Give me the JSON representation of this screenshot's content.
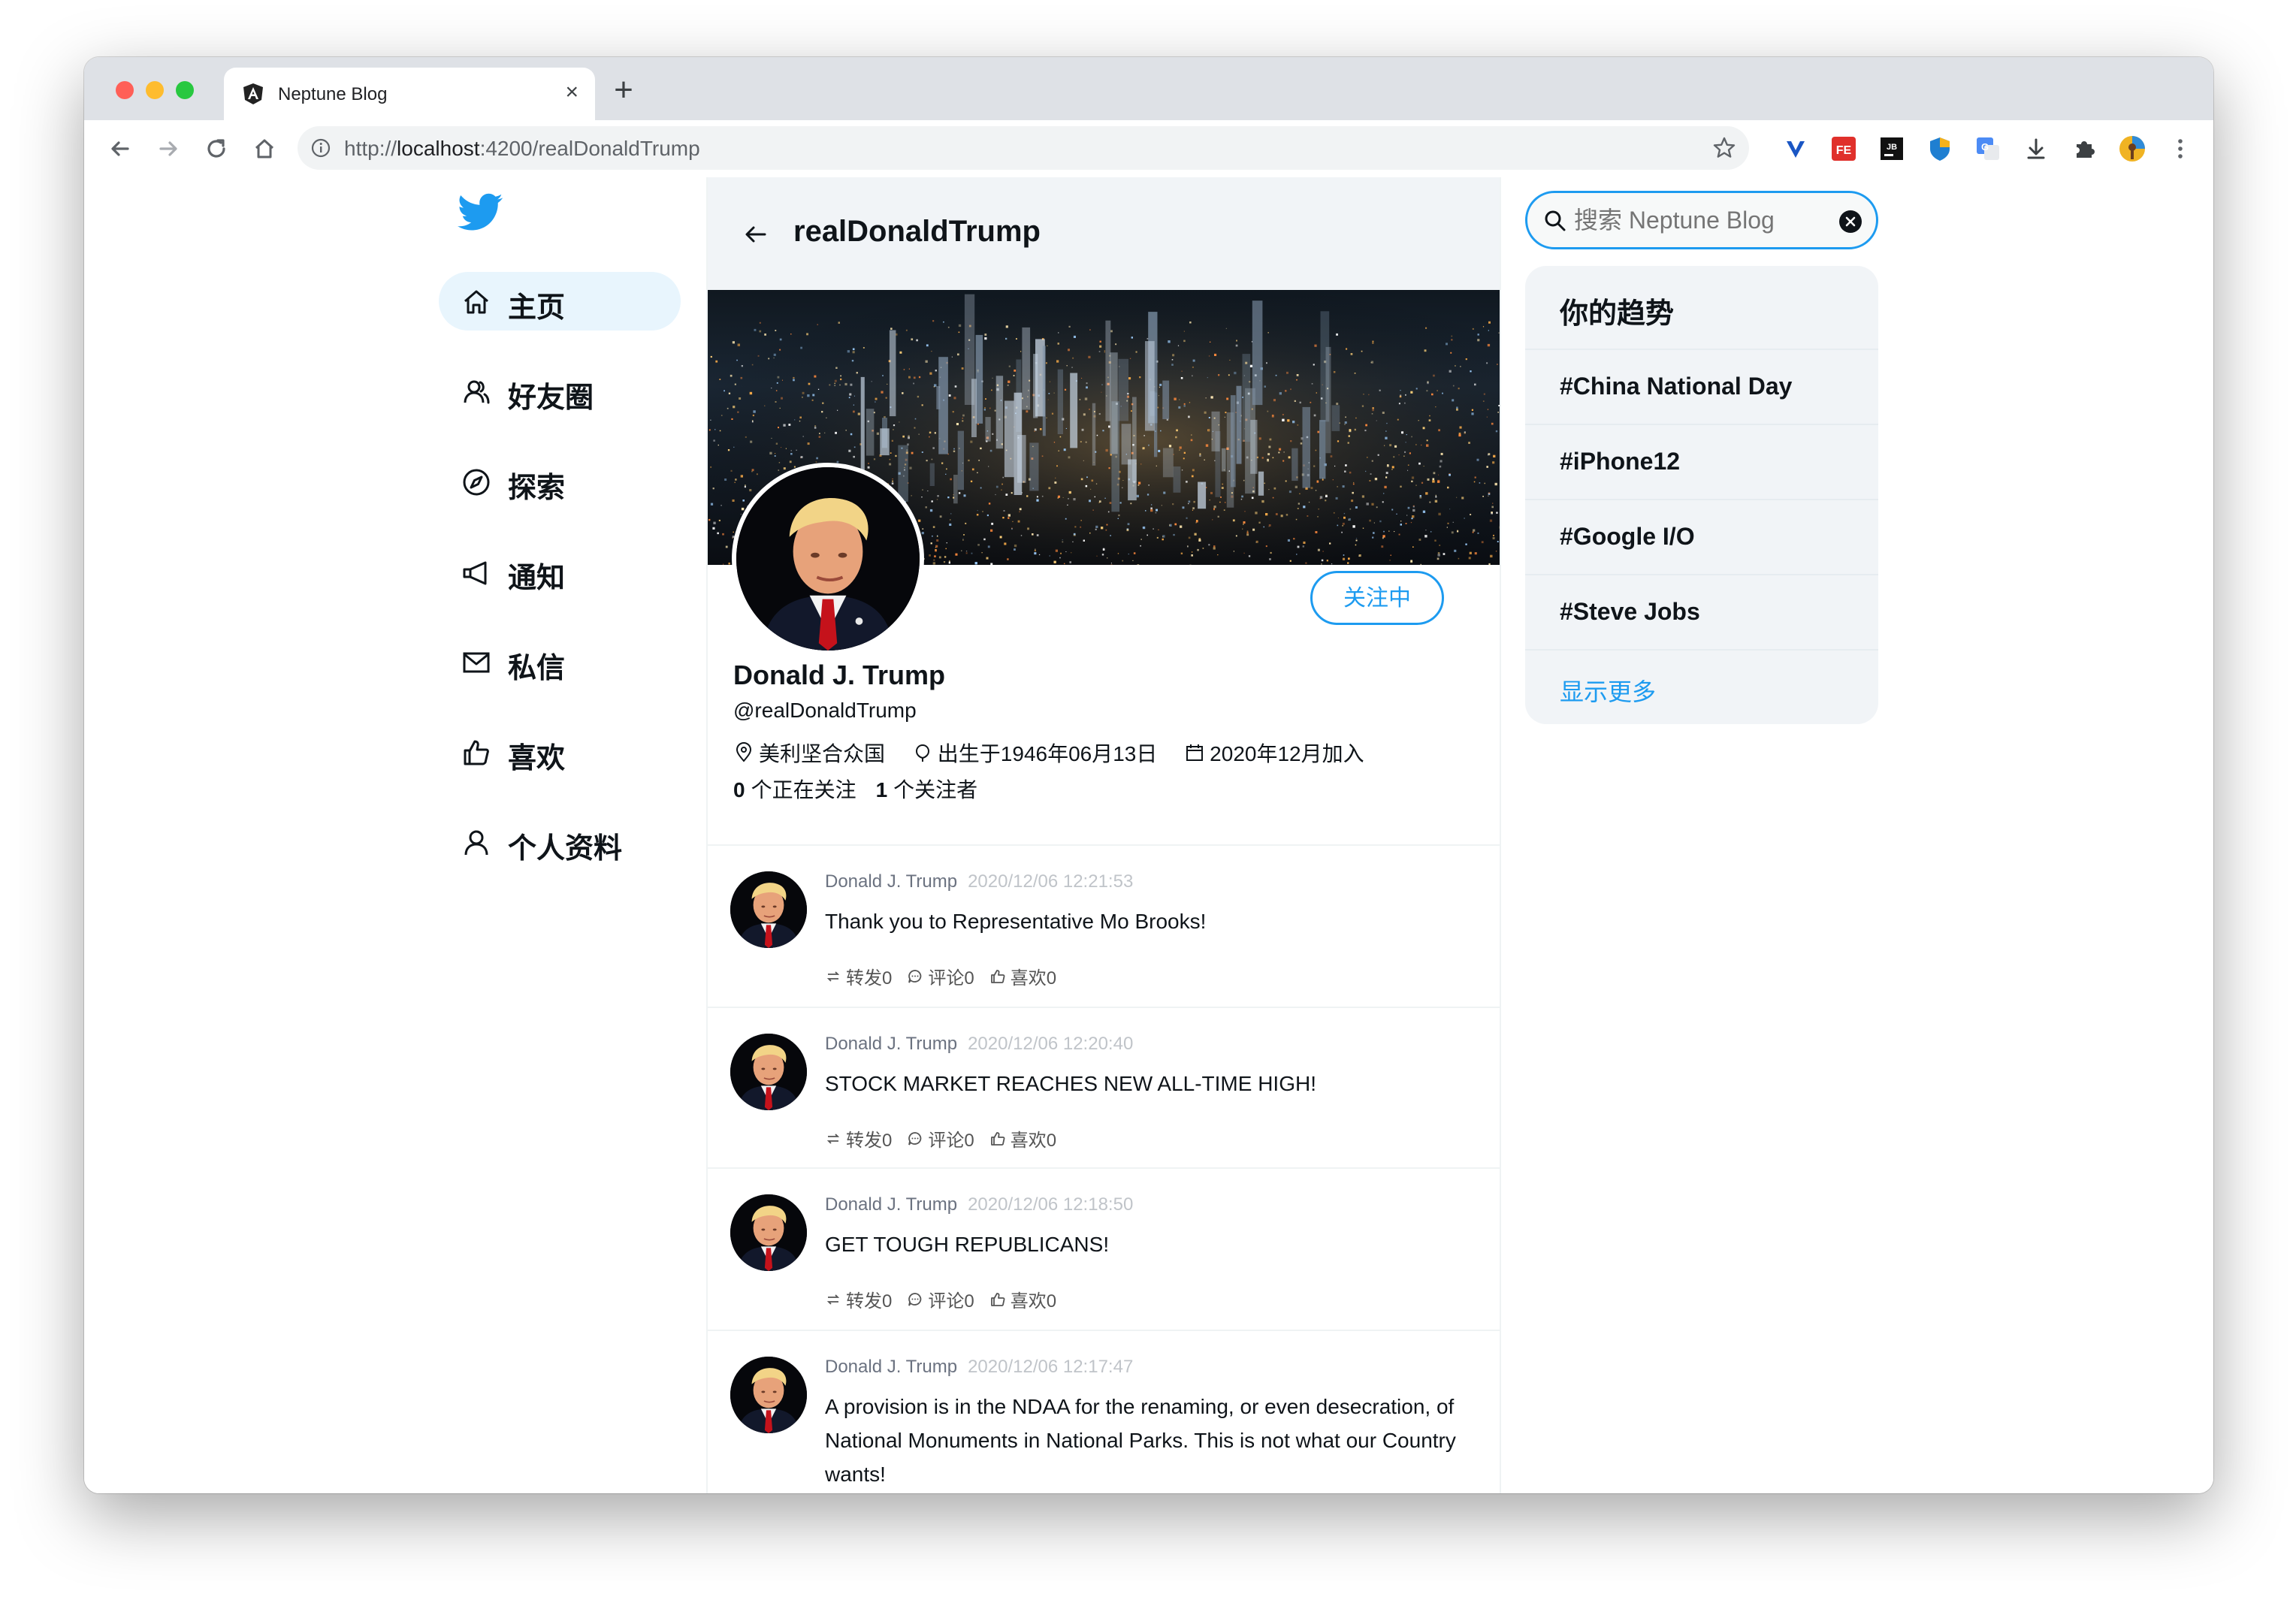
{
  "browser": {
    "tab_title": "Neptune Blog",
    "new_tab": "+",
    "url_prefix": "http://",
    "url_host": "localhost",
    "url_rest": ":4200/realDonaldTrump"
  },
  "sidebar": {
    "items": [
      {
        "label": "主页",
        "icon": "home-icon",
        "active": true
      },
      {
        "label": "好友圈",
        "icon": "friends-icon"
      },
      {
        "label": "探索",
        "icon": "compass-icon"
      },
      {
        "label": "通知",
        "icon": "megaphone-icon"
      },
      {
        "label": "私信",
        "icon": "mail-icon"
      },
      {
        "label": "喜欢",
        "icon": "thumbs-up-icon"
      },
      {
        "label": "个人资料",
        "icon": "user-icon"
      }
    ]
  },
  "profile": {
    "header_title": "realDonaldTrump",
    "follow_label": "关注中",
    "display_name": "Donald J. Trump",
    "handle": "@realDonaldTrump",
    "location": "美利坚合众国",
    "birth": "出生于1946年06月13日",
    "joined": "2020年12月加入",
    "following_count": "0",
    "following_label": "个正在关注",
    "followers_count": "1",
    "followers_label": "个关注者"
  },
  "tweets": [
    {
      "author": "Donald J. Trump",
      "time": "2020/12/06 12:21:53",
      "text": "Thank you to Representative Mo Brooks!",
      "retweet": "转发0",
      "comment": "评论0",
      "like": "喜欢0"
    },
    {
      "author": "Donald J. Trump",
      "time": "2020/12/06 12:20:40",
      "text": "STOCK MARKET REACHES NEW ALL-TIME HIGH!",
      "retweet": "转发0",
      "comment": "评论0",
      "like": "喜欢0"
    },
    {
      "author": "Donald J. Trump",
      "time": "2020/12/06 12:18:50",
      "text": "GET TOUGH REPUBLICANS!",
      "retweet": "转发0",
      "comment": "评论0",
      "like": "喜欢0"
    },
    {
      "author": "Donald J. Trump",
      "time": "2020/12/06 12:17:47",
      "text": "A provision is in the NDAA for the renaming, or even desecration, of National Monuments in National Parks. This is not what our Country wants!"
    }
  ],
  "search": {
    "placeholder": "搜索 Neptune Blog"
  },
  "trends": {
    "title": "你的趋势",
    "items": [
      "#China National Day",
      "#iPhone12",
      "#Google I/O",
      "#Steve Jobs"
    ],
    "show_more": "显示更多"
  },
  "colors": {
    "accent": "#1d9bf0",
    "active_nav_bg": "#e8f5fd",
    "panel_bg": "#f1f4f7"
  }
}
